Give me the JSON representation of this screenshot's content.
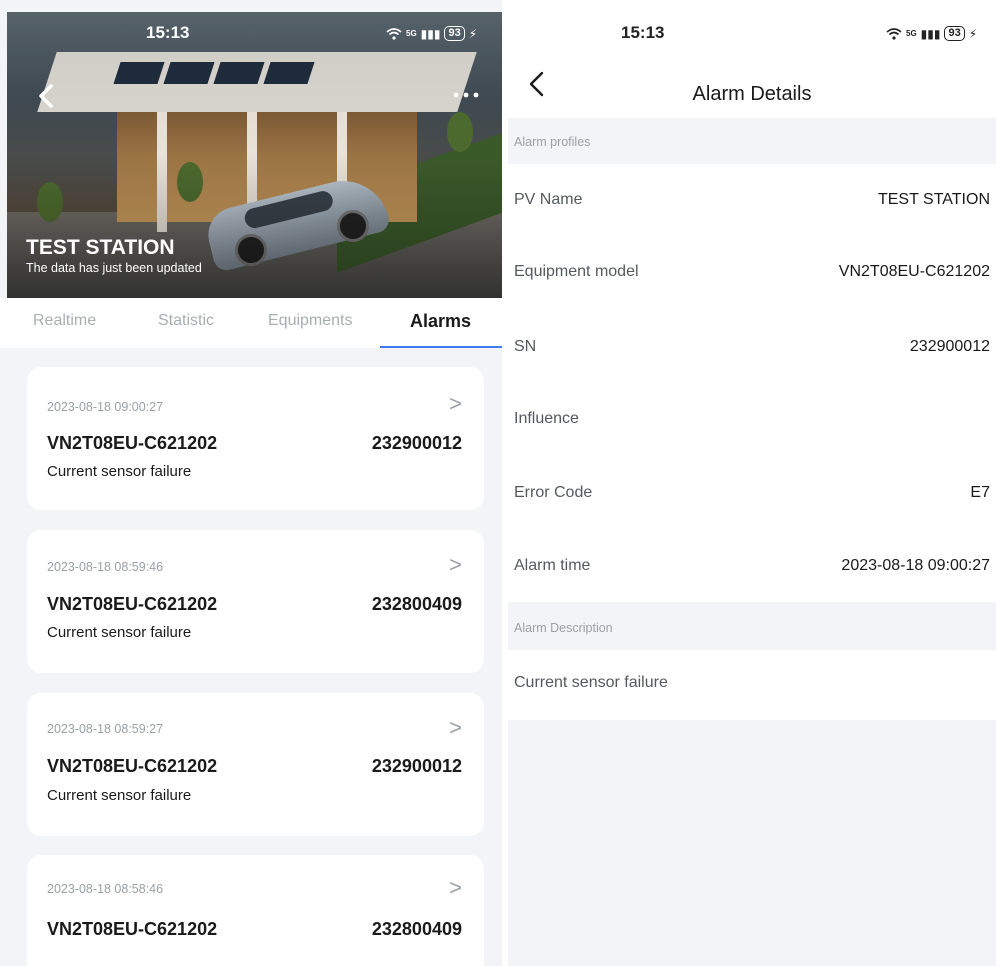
{
  "left_screen": {
    "status_bar": {
      "time": "15:13",
      "battery": "93",
      "signal": "5G"
    },
    "station": {
      "name": "TEST STATION",
      "subtitle": "The data has just been updated"
    },
    "tabs": [
      {
        "label": "Realtime",
        "active": false
      },
      {
        "label": "Statistic",
        "active": false
      },
      {
        "label": "Equipments",
        "active": false
      },
      {
        "label": "Alarms",
        "active": true
      }
    ],
    "alarms": [
      {
        "timestamp": "2023-08-18 09:00:27",
        "model": "VN2T08EU-C621202",
        "sn": "232900012",
        "fault": "Current sensor failure"
      },
      {
        "timestamp": "2023-08-18 08:59:46",
        "model": "VN2T08EU-C621202",
        "sn": "232800409",
        "fault": "Current sensor failure"
      },
      {
        "timestamp": "2023-08-18 08:59:27",
        "model": "VN2T08EU-C621202",
        "sn": "232900012",
        "fault": "Current sensor failure"
      },
      {
        "timestamp": "2023-08-18 08:58:46",
        "model": "VN2T08EU-C621202",
        "sn": "232800409",
        "fault": ""
      }
    ]
  },
  "right_screen": {
    "status_bar": {
      "time": "15:13",
      "battery": "93",
      "signal": "5G"
    },
    "title": "Alarm Details",
    "sections": {
      "profiles_label": "Alarm profiles",
      "description_label": "Alarm Description"
    },
    "details": [
      {
        "label": "PV Name",
        "value": "TEST STATION"
      },
      {
        "label": "Equipment model",
        "value": "VN2T08EU-C621202"
      },
      {
        "label": "SN",
        "value": "232900012"
      },
      {
        "label": "Influence",
        "value": ""
      },
      {
        "label": "Error Code",
        "value": "E7"
      },
      {
        "label": "Alarm time",
        "value": "2023-08-18 09:00:27"
      }
    ],
    "description": "Current sensor failure"
  },
  "colors": {
    "accent": "#3e7bf0",
    "muted": "#9aa0a6",
    "background": "#f3f4f7"
  },
  "icons": {
    "back": "chevron-left-icon",
    "more": "more-icon",
    "wifi": "wifi-icon",
    "chevron": "chevron-right-icon"
  }
}
